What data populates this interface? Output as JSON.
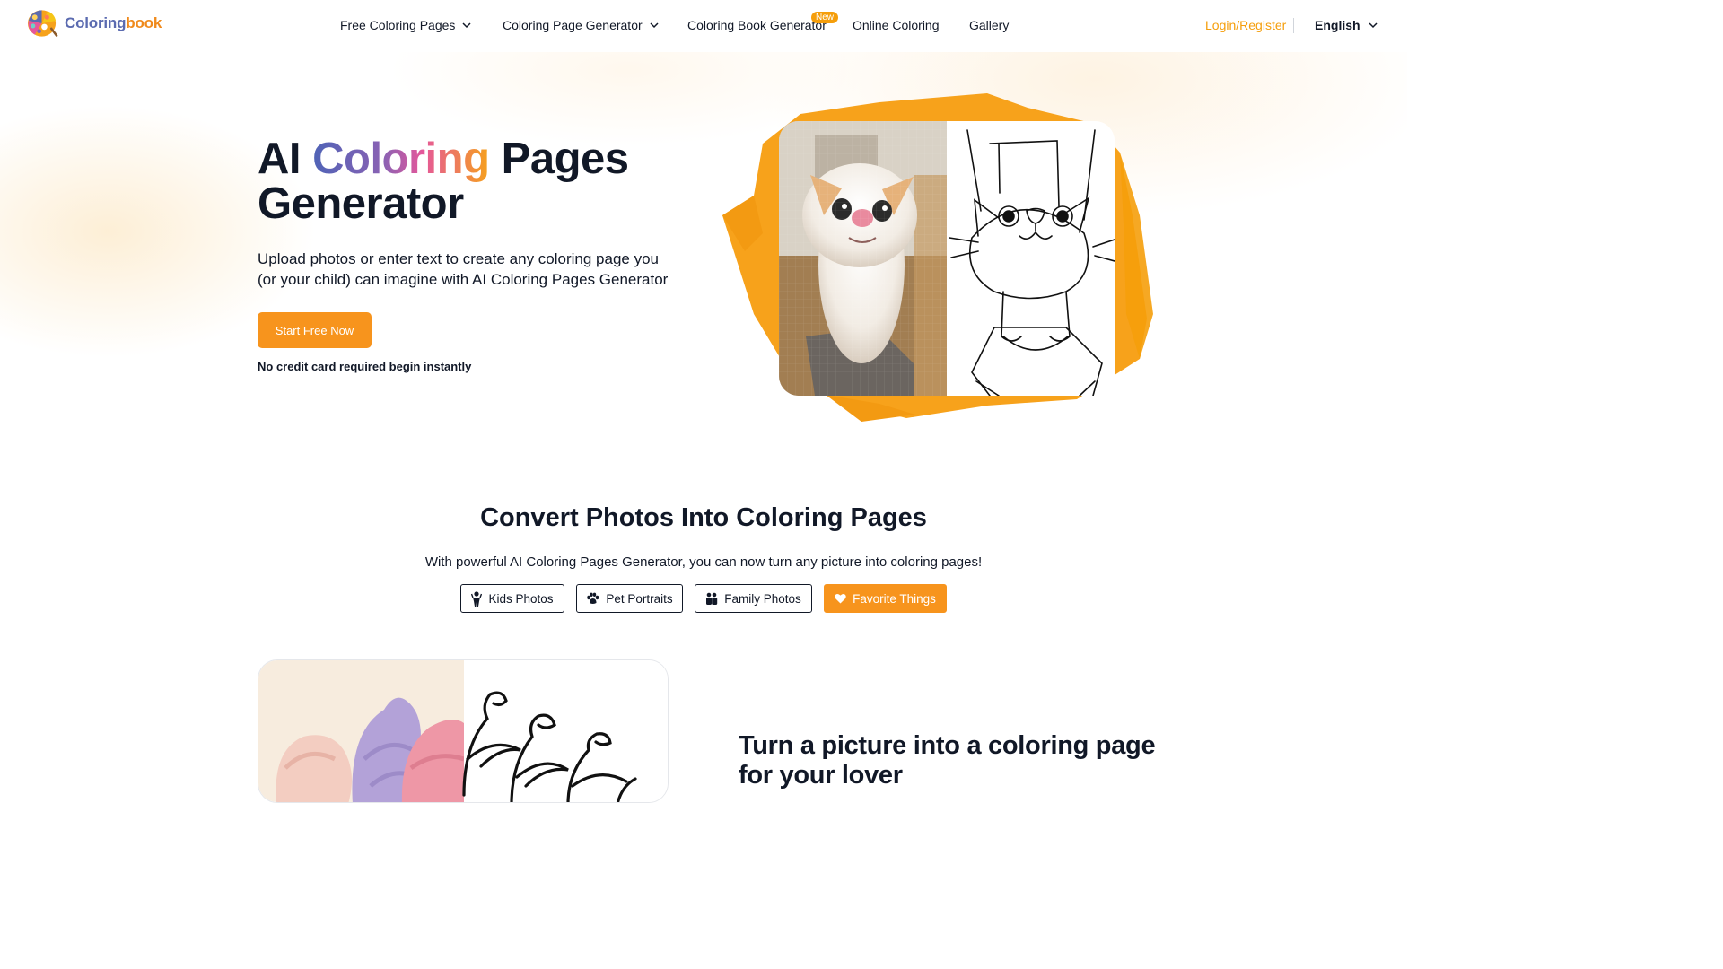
{
  "brand": {
    "name_part1": "Coloring",
    "name_part2": "book"
  },
  "nav": {
    "items": [
      {
        "label": "Free Coloring Pages",
        "dropdown": true
      },
      {
        "label": "Coloring Page Generator",
        "dropdown": true
      },
      {
        "label": "Coloring Book Generator",
        "dropdown": false,
        "badge": "New"
      },
      {
        "label": "Online Coloring",
        "dropdown": false
      },
      {
        "label": "Gallery",
        "dropdown": false
      }
    ],
    "login": "Login/Register",
    "language": "English"
  },
  "hero": {
    "title_word1": "AI",
    "title_highlight": "Coloring",
    "title_rest": "Pages Generator",
    "subtitle": "Upload photos or enter text to create any coloring page you (or your child) can imagine with AI Coloring Pages Generator",
    "cta": "Start Free Now",
    "note": "No credit card required begin instantly"
  },
  "convert": {
    "title": "Convert Photos Into Coloring Pages",
    "subtitle": "With powerful AI Coloring Pages Generator, you can now turn any picture into coloring pages!",
    "tabs": [
      {
        "label": "Kids Photos",
        "icon": "child-icon",
        "active": false
      },
      {
        "label": "Pet Portraits",
        "icon": "paw-icon",
        "active": false
      },
      {
        "label": "Family Photos",
        "icon": "family-icon",
        "active": false
      },
      {
        "label": "Favorite Things",
        "icon": "heart-icon",
        "active": true
      }
    ]
  },
  "feature": {
    "title": "Turn a picture into a coloring page for your lover"
  },
  "colors": {
    "accent": "#f7941d",
    "login": "#f59e0b",
    "text": "#111827"
  }
}
